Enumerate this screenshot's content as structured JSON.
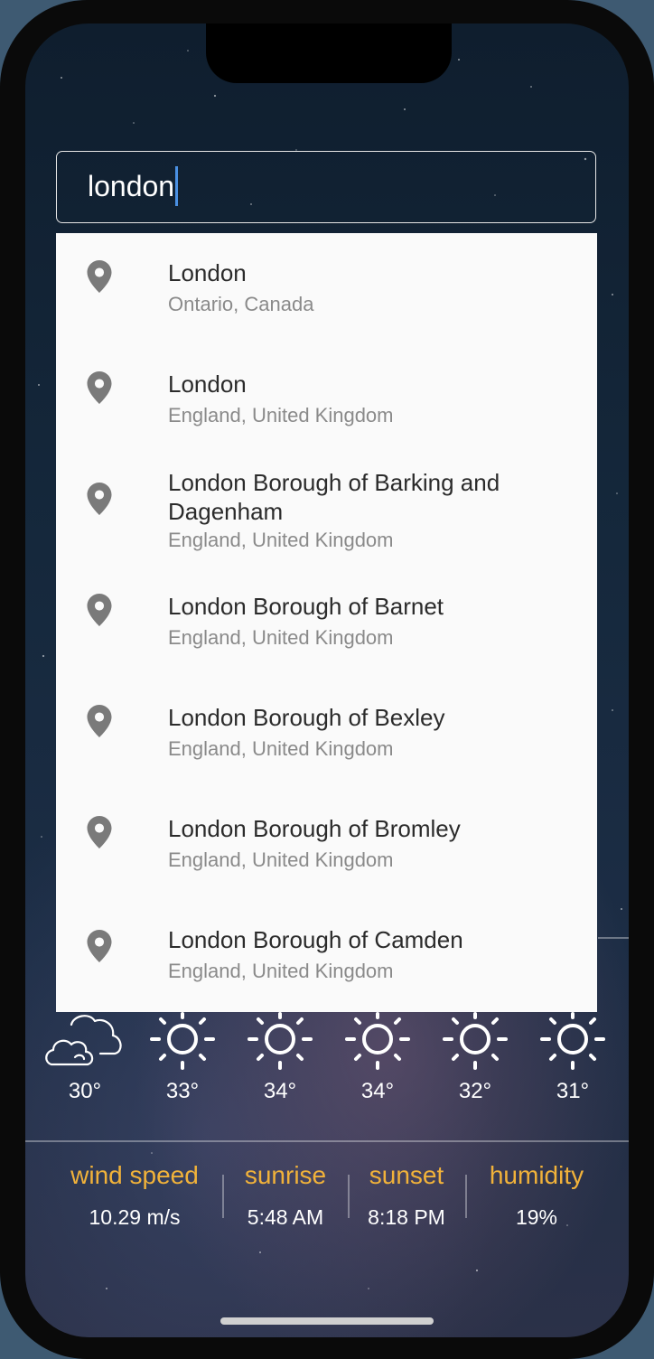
{
  "search": {
    "value": "london"
  },
  "suggestions": [
    {
      "title": "London",
      "subtitle": "Ontario, Canada",
      "icon": "location-pin-icon"
    },
    {
      "title": "London",
      "subtitle": "England, United Kingdom",
      "icon": "location-pin-icon"
    },
    {
      "title": "London Borough of Barking and Dagenham",
      "subtitle": "England, United Kingdom",
      "icon": "location-pin-icon"
    },
    {
      "title": "London Borough of Barnet",
      "subtitle": "England, United Kingdom",
      "icon": "location-pin-icon"
    },
    {
      "title": "London Borough of Bexley",
      "subtitle": "England, United Kingdom",
      "icon": "location-pin-icon"
    },
    {
      "title": "London Borough of Bromley",
      "subtitle": "England, United Kingdom",
      "icon": "location-pin-icon"
    },
    {
      "title": "London Borough of Camden",
      "subtitle": "England, United Kingdom",
      "icon": "location-pin-icon"
    }
  ],
  "hourly": [
    {
      "temp": "30°",
      "icon": "cloud-icon"
    },
    {
      "temp": "33°",
      "icon": "sun-icon"
    },
    {
      "temp": "34°",
      "icon": "sun-icon"
    },
    {
      "temp": "34°",
      "icon": "sun-icon"
    },
    {
      "temp": "32°",
      "icon": "sun-icon"
    },
    {
      "temp": "31°",
      "icon": "sun-icon"
    }
  ],
  "stats": [
    {
      "label": "wind speed",
      "value": "10.29 m/s"
    },
    {
      "label": "sunrise",
      "value": "5:48 AM"
    },
    {
      "label": "sunset",
      "value": "8:18 PM"
    },
    {
      "label": "humidity",
      "value": "19%"
    }
  ],
  "colors": {
    "accent": "#f1b23a",
    "caret": "#4a90e2",
    "dropdown_bg": "#fafafa",
    "pin": "#7a7a7a"
  }
}
